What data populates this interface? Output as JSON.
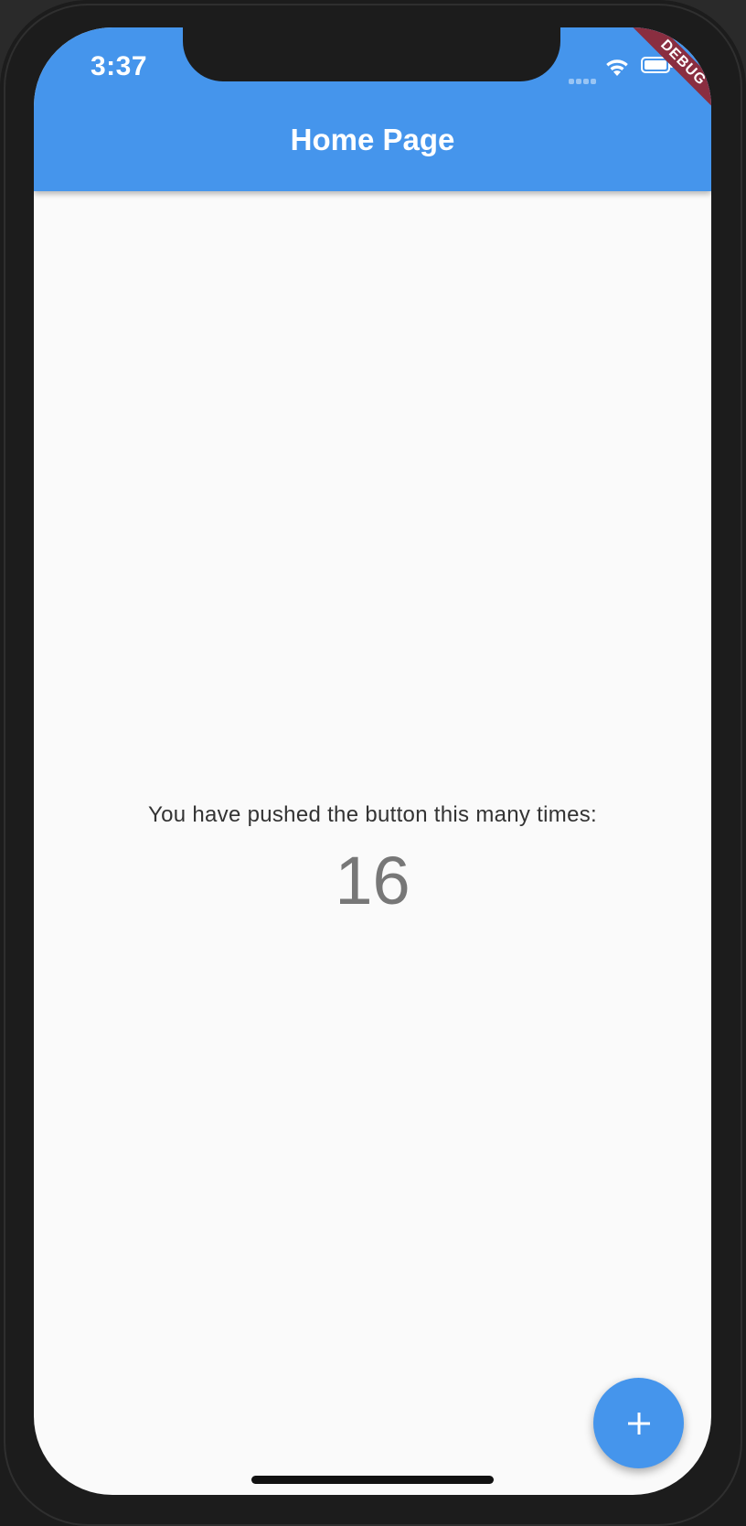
{
  "status_bar": {
    "time": "3:37",
    "wifi_icon": "wifi-icon",
    "battery_icon": "battery-icon",
    "signal_icon": "cellular-signal-icon"
  },
  "app_bar": {
    "title": "Home Page",
    "color": "#4595ec"
  },
  "debug_banner": {
    "label": "DEBUG",
    "color": "#8a2e40"
  },
  "main": {
    "label": "You have pushed the button this many times:",
    "counter": "16"
  },
  "fab": {
    "icon": "add-icon",
    "color": "#4595ec"
  }
}
